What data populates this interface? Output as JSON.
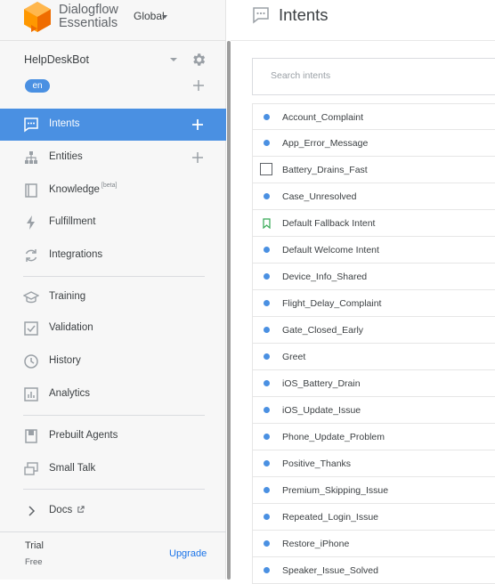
{
  "brand": {
    "line1": "Dialogflow",
    "line2": "Essentials",
    "region": "Global",
    "logo_color": "#ff9800"
  },
  "agent": {
    "name": "HelpDeskBot",
    "language": "en"
  },
  "nav": {
    "intents": "Intents",
    "entities": "Entities",
    "knowledge": "Knowledge",
    "knowledge_badge": "[beta]",
    "fulfillment": "Fulfillment",
    "integrations": "Integrations",
    "training": "Training",
    "validation": "Validation",
    "history": "History",
    "analytics": "Analytics",
    "prebuilt_agents": "Prebuilt Agents",
    "small_talk": "Small Talk",
    "docs": "Docs"
  },
  "plan": {
    "trial": "Trial",
    "tier": "Free",
    "upgrade": "Upgrade"
  },
  "header": {
    "title": "Intents"
  },
  "search": {
    "placeholder": "Search intents",
    "value": ""
  },
  "intents": [
    {
      "name": "Account_Complaint",
      "marker": "dot"
    },
    {
      "name": "App_Error_Message",
      "marker": "dot"
    },
    {
      "name": "Battery_Drains_Fast",
      "marker": "checkbox"
    },
    {
      "name": "Case_Unresolved",
      "marker": "dot"
    },
    {
      "name": "Default Fallback Intent",
      "marker": "fallback-flag"
    },
    {
      "name": "Default Welcome Intent",
      "marker": "dot"
    },
    {
      "name": "Device_Info_Shared",
      "marker": "dot"
    },
    {
      "name": "Flight_Delay_Complaint",
      "marker": "dot"
    },
    {
      "name": "Gate_Closed_Early",
      "marker": "dot"
    },
    {
      "name": "Greet",
      "marker": "dot"
    },
    {
      "name": "iOS_Battery_Drain",
      "marker": "dot"
    },
    {
      "name": "iOS_Update_Issue",
      "marker": "dot"
    },
    {
      "name": "Phone_Update_Problem",
      "marker": "dot"
    },
    {
      "name": "Positive_Thanks",
      "marker": "dot"
    },
    {
      "name": "Premium_Skipping_Issue",
      "marker": "dot"
    },
    {
      "name": "Repeated_Login_Issue",
      "marker": "dot"
    },
    {
      "name": "Restore_iPhone",
      "marker": "dot"
    },
    {
      "name": "Speaker_Issue_Solved",
      "marker": "dot"
    }
  ],
  "colors": {
    "accent": "#4a90e2",
    "fallback": "#34a853"
  }
}
